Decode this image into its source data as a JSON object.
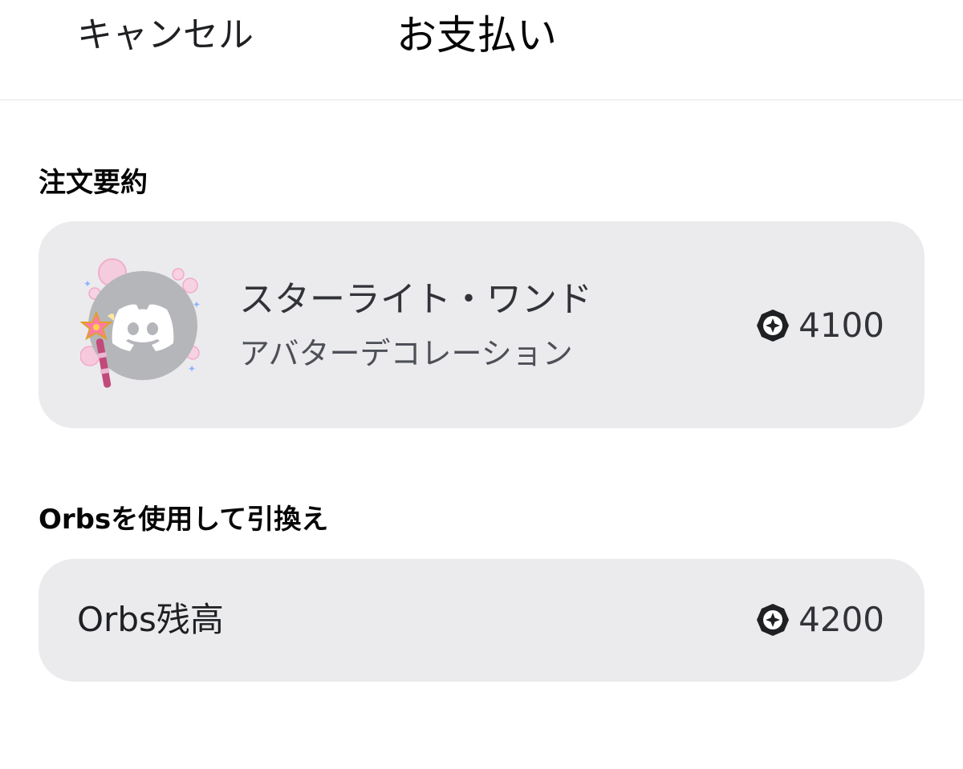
{
  "header": {
    "cancel_label": "キャンセル",
    "title": "お支払い"
  },
  "order_summary": {
    "section_label": "注文要約",
    "item": {
      "name": "スターライト・ワンド",
      "type": "アバターデコレーション",
      "price": "4100",
      "currency_icon": "orb-icon",
      "avatar_icon": "discord-logo-icon",
      "decoration_icon": "starlight-wand-icon"
    }
  },
  "redeem": {
    "section_label": "Orbsを使用して引換え",
    "balance_label": "Orbs残高",
    "balance_value": "4200",
    "currency_icon": "orb-icon"
  },
  "colors": {
    "card_background": "#ebebed",
    "avatar_gray": "#b5b6ba",
    "text_primary": "#060607"
  }
}
